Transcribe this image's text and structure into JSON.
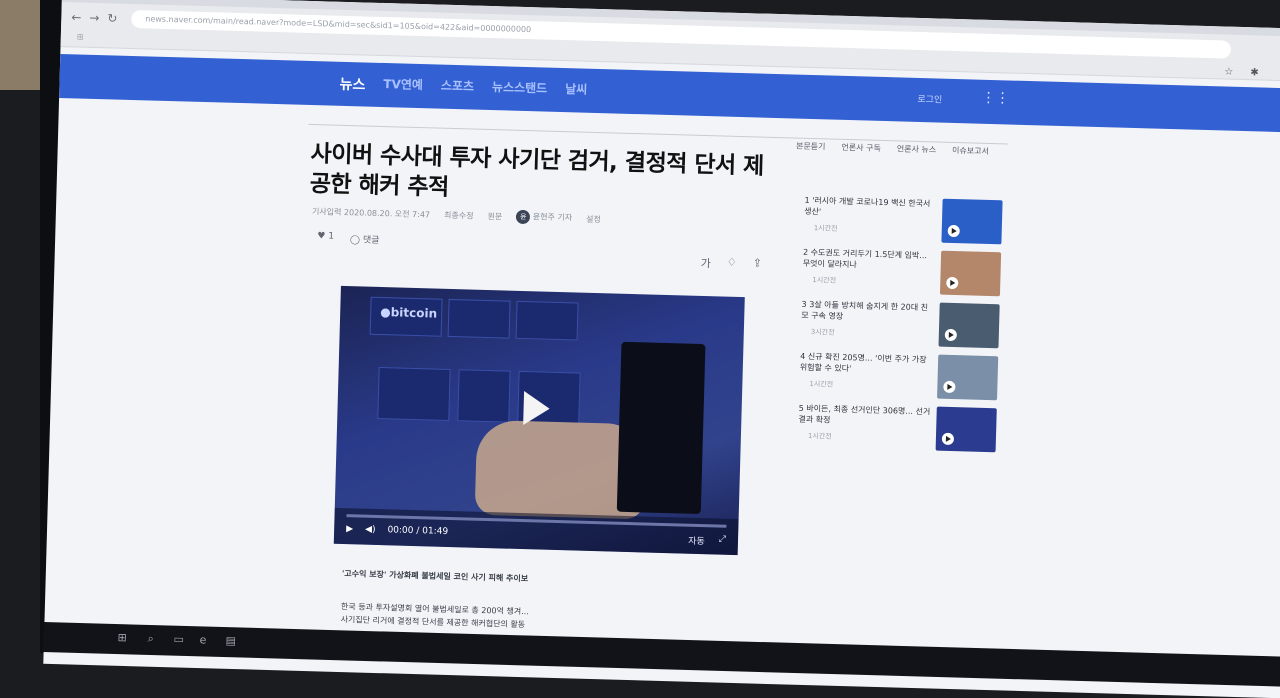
{
  "browser": {
    "url": "news.naver.com/main/read.naver?mode=LSD&mid=sec&sid1=105&oid=422&aid=0000000000",
    "back_icon": "←",
    "forward_icon": "→",
    "reload_icon": "↻",
    "star_icon": "☆",
    "ext_icon": "✱",
    "apps_label": "⊞"
  },
  "header": {
    "nav": [
      "뉴스",
      "TV연예",
      "스포츠",
      "뉴스스탠드",
      "날씨"
    ],
    "login": "로그인",
    "grid_icon": "⋮⋮"
  },
  "article_tools": [
    "본문듣기",
    "언론사 구독",
    "언론사 뉴스",
    "이슈보고서"
  ],
  "article": {
    "title": "사이버 수사대 투자 사기단 검거, 결정적 단서 제공한 해커 추적",
    "byline": {
      "time": "기사입력 2020.08.20. 오전 7:47",
      "modified": "최종수정",
      "original": "원문",
      "reporter": "윤현주 기자",
      "reporter_initial": "윤",
      "subscribe": "설정"
    },
    "reactions": {
      "like_icon": "♥",
      "like_count": "1",
      "comment_icon": "◯",
      "comment_label": "댓글"
    },
    "tools": {
      "font_icon": "가",
      "alarm_icon": "♢",
      "share_icon": "⇪"
    }
  },
  "video": {
    "brand": "●bitcoin",
    "time": "00:00 / 01:49",
    "volume_icon": "◀)",
    "play_small": "▶",
    "quality": "자동",
    "fullscreen_icon": "⤢"
  },
  "body": {
    "caption": "'고수익 보장' 가상화폐 불법세일 코인 사기 피해 추이보",
    "line1": "한국 등과 투자설명회 열어 불법세일로 총 200억 챙겨...",
    "line2": "사기집단 리거에 결정적 단서를 제공한 해커협단의 활동"
  },
  "ranking": [
    {
      "num": "1",
      "text": "'러시아 개발 코로나19 백신 한국서 생산'",
      "meta": "1시간전",
      "thumb_color": "#2a5fc8"
    },
    {
      "num": "2",
      "text": "수도권도 거리두기 1.5단계 임박... 무엇이 달라지나",
      "meta": "1시간전",
      "thumb_color": "#b4866a"
    },
    {
      "num": "3",
      "text": "3살 아들 방치해 숨지게 한 20대 친모 구속 영장",
      "meta": "3시간전",
      "thumb_color": "#4a5c70"
    },
    {
      "num": "4",
      "text": "신규 확진 205명... '이번 주가 가장 위험할 수 있다'",
      "meta": "1시간전",
      "thumb_color": "#7c8fa8"
    },
    {
      "num": "5",
      "text": "바이든, 최종 선거인단 306명... 선거 결과 확정",
      "meta": "1시간전",
      "thumb_color": "#2b3b8f"
    }
  ],
  "taskbar": {
    "start_icon": "⊞",
    "search_icon": "⌕",
    "view_icon": "▭",
    "edge_icon": "e",
    "files_icon": "▤"
  }
}
